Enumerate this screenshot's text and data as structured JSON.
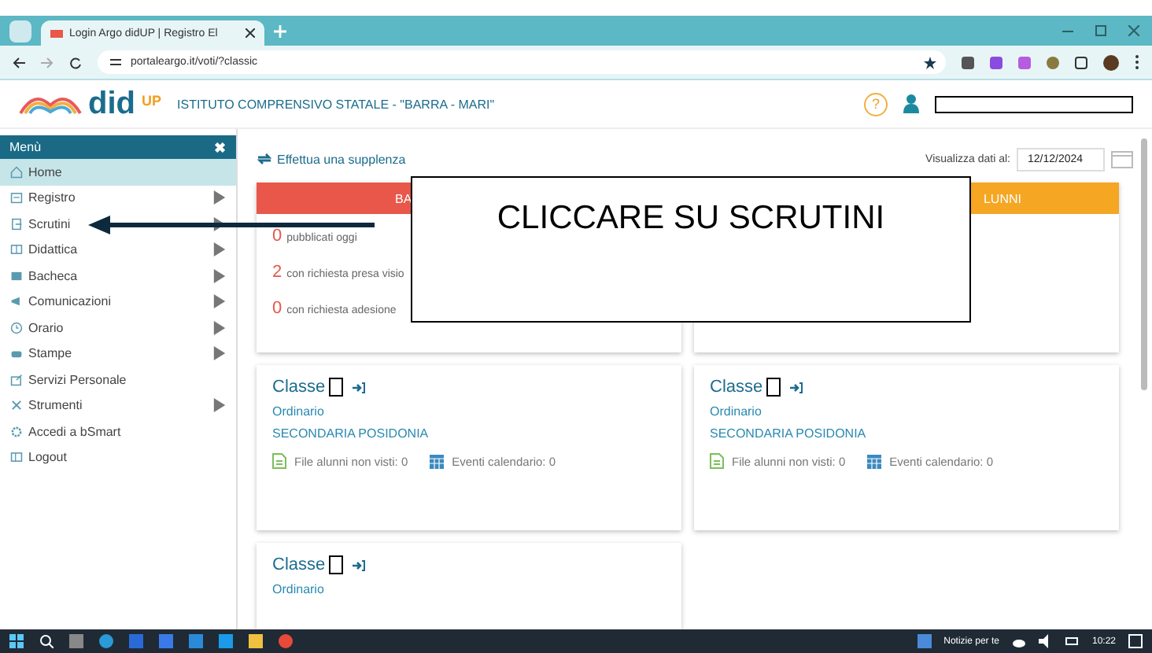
{
  "browser": {
    "tab_title": "Login Argo didUP | Registro El",
    "url": "portaleargo.it/voti/?classic"
  },
  "header": {
    "logo_text": "did",
    "logo_sup": "UP",
    "school": "ISTITUTO COMPRENSIVO STATALE - \"BARRA - MARI\"",
    "help_icon": "?"
  },
  "sidebar": {
    "title": "Menù",
    "close_icon": "✖",
    "items": [
      {
        "label": "Home",
        "selected": true,
        "has_submenu": false
      },
      {
        "label": "Registro",
        "selected": false,
        "has_submenu": true
      },
      {
        "label": "Scrutini",
        "selected": false,
        "has_submenu": true
      },
      {
        "label": "Didattica",
        "selected": false,
        "has_submenu": true
      },
      {
        "label": "Bacheca",
        "selected": false,
        "has_submenu": true
      },
      {
        "label": "Comunicazioni",
        "selected": false,
        "has_submenu": true
      },
      {
        "label": "Orario",
        "selected": false,
        "has_submenu": true
      },
      {
        "label": "Stampe",
        "selected": false,
        "has_submenu": true
      },
      {
        "label": "Servizi Personale",
        "selected": false,
        "has_submenu": false
      },
      {
        "label": "Strumenti",
        "selected": false,
        "has_submenu": true
      },
      {
        "label": "Accedi a bSmart",
        "selected": false,
        "has_submenu": false
      },
      {
        "label": "Logout",
        "selected": false,
        "has_submenu": false
      }
    ]
  },
  "main": {
    "action_link": "Effettua una supplenza",
    "date_label": "Visualizza dati al:",
    "date_value": "12/12/2024",
    "summary_cards": [
      {
        "header": "BA",
        "color": "#e8574a",
        "rows": [
          {
            "count": "0",
            "text": "pubblicati oggi"
          },
          {
            "count": "2",
            "text": "con richiesta presa visio"
          },
          {
            "count": "0",
            "text": "con richiesta adesione"
          }
        ]
      },
      {
        "header": "LUNNI",
        "color": "#f5a623"
      }
    ],
    "class_cards": [
      {
        "title": "Classe",
        "type": "Ordinario",
        "school": "SECONDARIA POSIDONIA",
        "stats": [
          {
            "kind": "file",
            "text": "File alunni non visti: 0"
          },
          {
            "kind": "calendar",
            "text": "Eventi calendario: 0"
          }
        ]
      },
      {
        "title": "Classe",
        "type": "Ordinario",
        "school": "SECONDARIA POSIDONIA",
        "stats": [
          {
            "kind": "file",
            "text": "File alunni non visti: 0"
          },
          {
            "kind": "calendar",
            "text": "Eventi calendario: 0"
          }
        ]
      },
      {
        "title": "Classe",
        "type": "Ordinario"
      }
    ]
  },
  "annotation": {
    "text": "CLICCARE SU SCRUTINI"
  },
  "taskbar": {
    "news": "Notizie per te",
    "time": "10:22"
  }
}
